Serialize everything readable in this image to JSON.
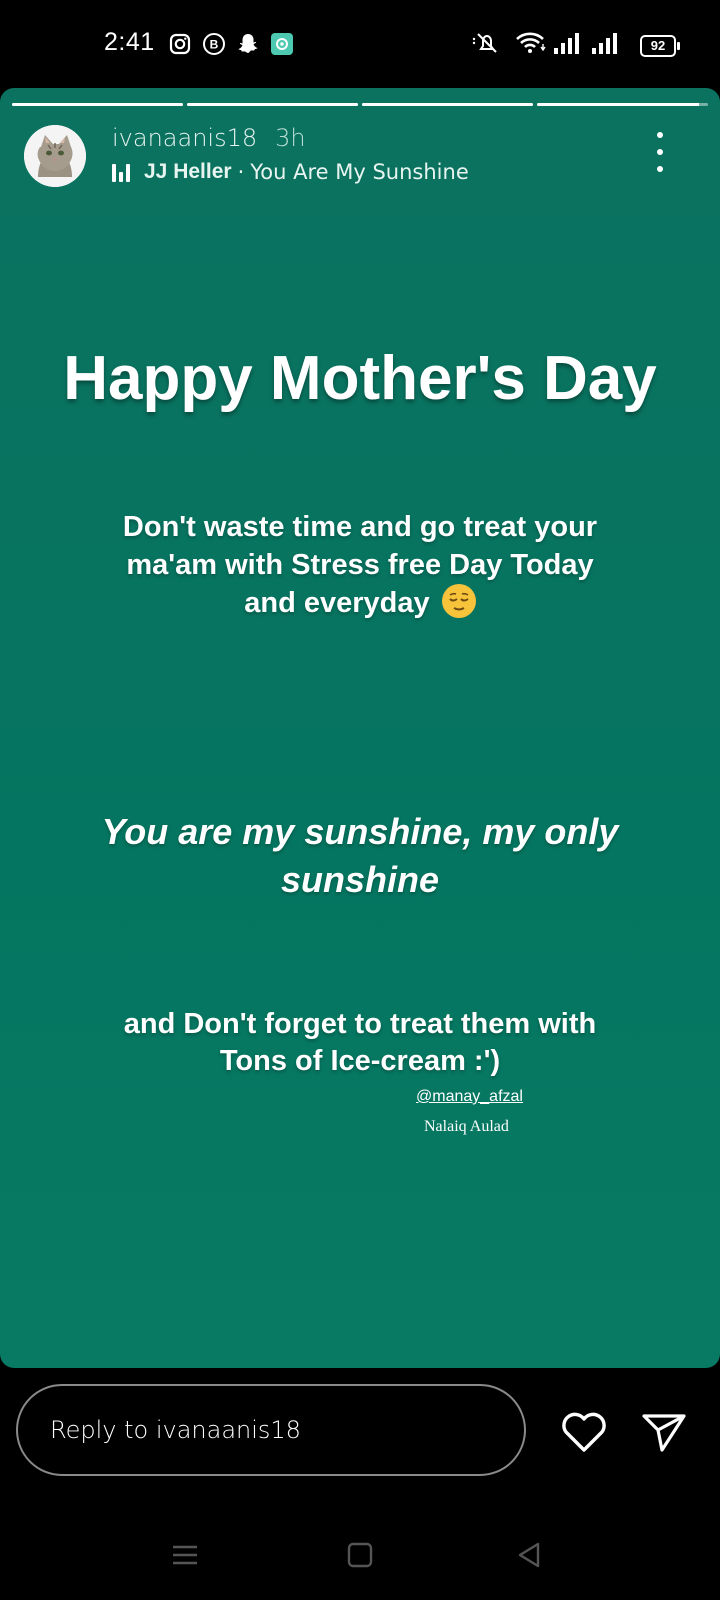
{
  "status_bar": {
    "time": "2:41",
    "battery": "92",
    "left_icons": [
      "instagram-icon",
      "b-badge-icon",
      "snapchat-icon",
      "app-icon"
    ],
    "right_icons": [
      "mute-icon",
      "wifi-icon",
      "signal-icon",
      "signal-icon-2"
    ]
  },
  "story": {
    "username": "ivanaanis18",
    "time_ago": "3h",
    "music_artist": "JJ Heller",
    "music_separator": "·",
    "music_song": "You Are My Sunshine",
    "progress": [
      1,
      1,
      1,
      0.95
    ],
    "headline": "Happy Mother's Day",
    "message1": "Don't waste time and go treat your ma'am with Stress free Day Today and everyday",
    "message2": "You are my sunshine, my only sunshine",
    "message3": "and Don't forget to treat them with Tons of Ice-cream :')",
    "mention": "@manay_afzal",
    "signature": "Nalaiq Aulad",
    "background_color": "#047560"
  },
  "reply": {
    "placeholder": "Reply to ivanaanis18"
  },
  "nav": {
    "items": [
      "menu-icon",
      "home-icon",
      "back-icon"
    ]
  }
}
